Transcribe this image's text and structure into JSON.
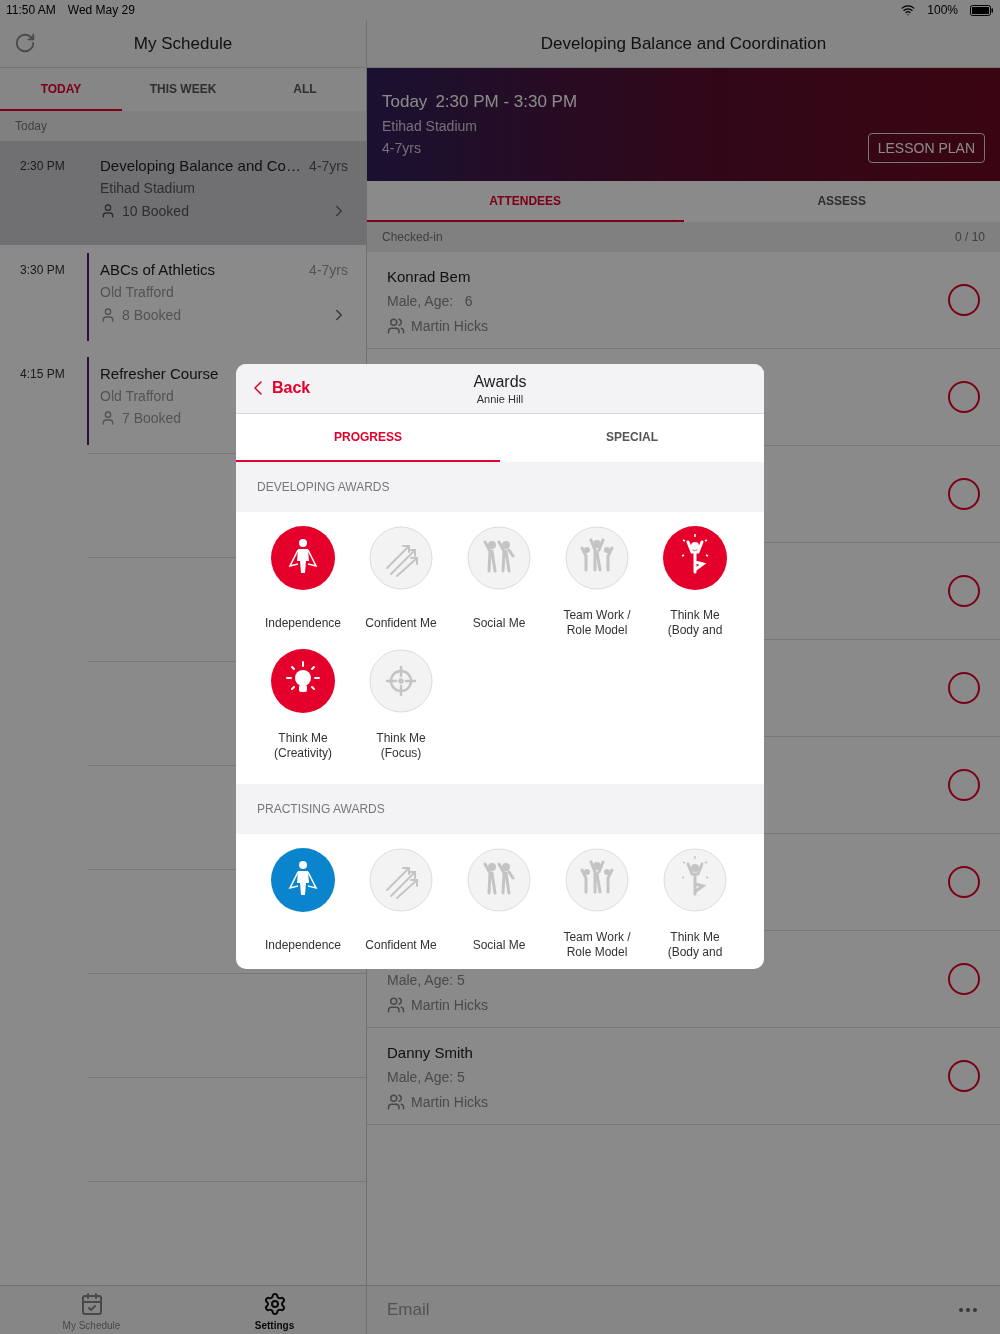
{
  "status_bar": {
    "time": "11:50 AM",
    "date": "Wed May 29",
    "battery": "100%"
  },
  "schedule": {
    "title": "My Schedule",
    "tabs": [
      {
        "label": "TODAY",
        "selected": true
      },
      {
        "label": "THIS WEEK",
        "selected": false
      },
      {
        "label": "ALL",
        "selected": false
      }
    ],
    "section": "Today",
    "sessions": [
      {
        "time": "2:30 PM",
        "title": "Developing Balance and Co…",
        "age": "4-7yrs",
        "venue": "Etihad Stadium",
        "booked": "10 Booked",
        "chevron": true,
        "selected": true
      },
      {
        "time": "3:30 PM",
        "title": "ABCs of Athletics",
        "age": "4-7yrs",
        "venue": "Old Trafford",
        "booked": "8 Booked",
        "chevron": true,
        "selected": false
      },
      {
        "time": "4:15 PM",
        "title": "Refresher Course",
        "venue": "Old Trafford",
        "booked": "7 Booked",
        "selected": false
      }
    ]
  },
  "tab_bar": [
    {
      "kind": "calendar",
      "label": "My Schedule",
      "selected": false
    },
    {
      "kind": "settings",
      "label": "Settings",
      "selected": true
    }
  ],
  "lesson": {
    "title": "Developing Balance and Coordination",
    "hero": {
      "day": "Today",
      "time": "2:30 PM - 3:30 PM",
      "venue": "Etihad Stadium",
      "age": "4-7yrs",
      "button": "LESSON PLAN"
    },
    "tabs": [
      {
        "label": "ATTENDEES",
        "selected": true
      },
      {
        "label": "ASSESS",
        "selected": false
      }
    ],
    "checked_in": {
      "label": "Checked-in",
      "count": "0 / 10"
    },
    "attendees": [
      {
        "name": "Konrad Bem",
        "detail": "Male, Age:   6",
        "coach": "Martin Hicks",
        "checked": false
      },
      {
        "checked": false
      },
      {
        "checked": false
      },
      {
        "checked": false
      },
      {
        "checked": false
      },
      {
        "checked": false
      },
      {
        "checked": false
      },
      {
        "detail": "Male, Age: 5",
        "coach": "Martin Hicks",
        "checked": false
      },
      {
        "name": "Danny Smith",
        "detail": "Male, Age: 5",
        "coach": "Martin Hicks",
        "checked": false
      }
    ],
    "email": {
      "placeholder": "Email"
    }
  },
  "modal": {
    "back": "Back",
    "title": "Awards",
    "subtitle": "Annie Hill",
    "tabs": [
      {
        "label": "PROGRESS",
        "selected": true
      },
      {
        "label": "SPECIAL",
        "selected": false
      }
    ],
    "sections": [
      {
        "title": "DEVELOPING AWARDS",
        "color": "#e4002b",
        "awards": [
          {
            "kind": "hero",
            "label": "Independence",
            "earned": true
          },
          {
            "kind": "arrows",
            "label": "Confident Me",
            "earned": false
          },
          {
            "kind": "dancers",
            "label": "Social Me",
            "earned": false
          },
          {
            "kind": "team",
            "label": "Team Work / Role Model",
            "earned": false
          },
          {
            "kind": "balance",
            "label": "Think Me (Body and",
            "earned": true
          },
          {
            "kind": "bulb",
            "label": "Think Me (Creativity)",
            "earned": true
          },
          {
            "kind": "target",
            "label": "Think Me (Focus)",
            "earned": false
          }
        ]
      },
      {
        "title": "PRACTISING AWARDS",
        "color": "#0a84cc",
        "awards": [
          {
            "kind": "hero",
            "label": "Independence",
            "earned": true
          },
          {
            "kind": "arrows",
            "label": "Confident Me",
            "earned": false
          },
          {
            "kind": "dancers",
            "label": "Social Me",
            "earned": false
          },
          {
            "kind": "team",
            "label": "Team Work / Role Model",
            "earned": false
          },
          {
            "kind": "balance",
            "label": "Think Me (Body and",
            "earned": false
          }
        ]
      }
    ]
  }
}
